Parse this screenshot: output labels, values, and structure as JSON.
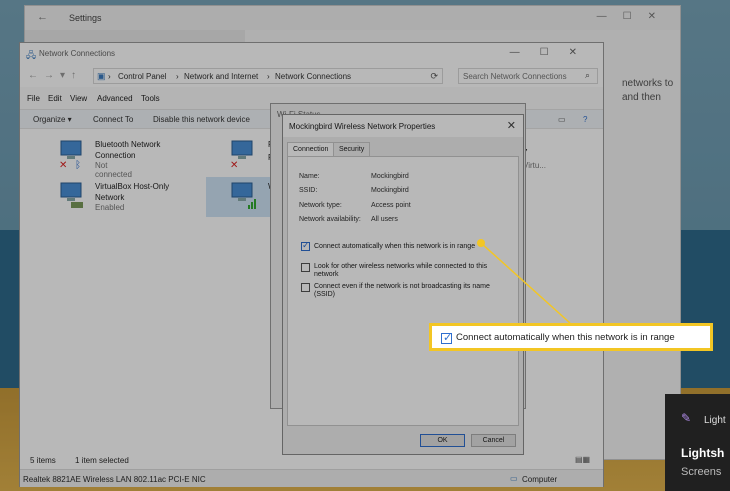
{
  "settings": {
    "title": "Settings",
    "partial_text_line1": "networks to",
    "partial_text_line2": "and then"
  },
  "network_connections": {
    "title": "Network Connections",
    "breadcrumbs": [
      "Control Panel",
      "Network and Internet",
      "Network Connections"
    ],
    "search_placeholder": "Search Network Connections",
    "menu": [
      "File",
      "Edit",
      "View",
      "Advanced",
      "Tools"
    ],
    "toolbar": [
      "Organize ▾",
      "Connect To",
      "Disable this network device"
    ],
    "connections": [
      {
        "name_line1": "Bluetooth Network",
        "name_line2": "Connection",
        "status": "Not connected"
      },
      {
        "name_line1": "VirtualBox Host-Only",
        "name_line2": "Network",
        "status": "Enabled"
      }
    ],
    "partial_conn_text": [
      "F",
      "F",
      "W"
    ],
    "partial_right_text": [
      "* 7",
      "Virtu..."
    ],
    "status_items": "5 items",
    "status_selected": "1 item selected",
    "adapter": "Realtek 8821AE Wireless LAN 802.11ac PCI-E NIC",
    "computer": "Computer"
  },
  "wifi_status": {
    "title": "Wi-Fi Status"
  },
  "properties": {
    "title": "Mockingbird Wireless Network Properties",
    "tabs": [
      "Connection",
      "Security"
    ],
    "fields": [
      {
        "key": "Name:",
        "value": "Mockingbird"
      },
      {
        "key": "SSID:",
        "value": "Mockingbird"
      },
      {
        "key": "Network type:",
        "value": "Access point"
      },
      {
        "key": "Network availability:",
        "value": "All users"
      }
    ],
    "options": [
      {
        "label": "Connect automatically when this network is in range",
        "checked": true
      },
      {
        "label": "Look for other wireless networks while connected to this network",
        "checked": false
      },
      {
        "label": "Connect even if the network is not broadcasting its name (SSID)",
        "checked": false
      }
    ],
    "ok": "OK",
    "cancel": "Cancel"
  },
  "callout": {
    "text": "Connect automatically when this network is in range",
    "accent": "#f3c624"
  },
  "lightshot": {
    "name": "Light",
    "title": "Lightsh",
    "body": "Screens"
  }
}
